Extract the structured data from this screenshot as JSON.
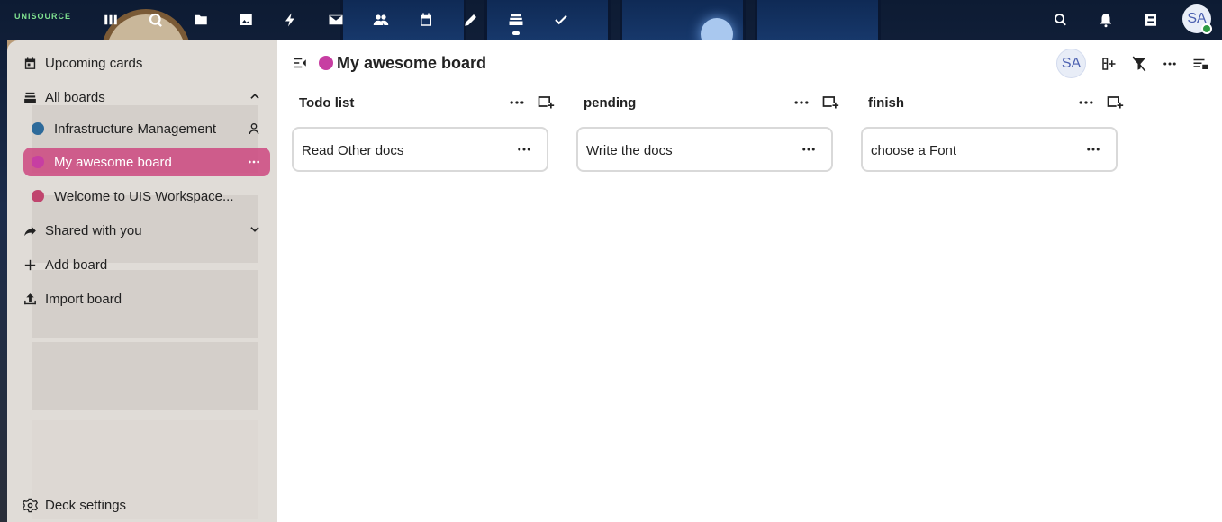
{
  "app": {
    "logo_text": "UNISOURCE",
    "nav_apps": [
      {
        "icon": "dashboard-icon"
      },
      {
        "icon": "search-app-icon"
      },
      {
        "icon": "files-icon"
      },
      {
        "icon": "photos-icon"
      },
      {
        "icon": "activity-icon"
      },
      {
        "icon": "mail-icon"
      },
      {
        "icon": "contacts-icon"
      },
      {
        "icon": "calendar-icon"
      },
      {
        "icon": "notes-icon"
      },
      {
        "icon": "deck-icon",
        "active": true
      },
      {
        "icon": "tasks-icon"
      }
    ],
    "right_icons": [
      "search-icon",
      "notifications-icon",
      "contacts-menu-icon"
    ],
    "user_initials": "SA",
    "user_status_color": "#2e9b43"
  },
  "sidebar": {
    "upcoming_label": "Upcoming cards",
    "all_boards_label": "All boards",
    "boards": [
      {
        "name": "Infrastructure Management",
        "color": "#2d6a9a",
        "shared": true
      },
      {
        "name": "My awesome board",
        "color": "#c73ea2",
        "active": true
      },
      {
        "name": "Welcome to UIS Workspace...",
        "color": "#c0456e"
      }
    ],
    "shared_label": "Shared with you",
    "add_board_label": "Add board",
    "import_board_label": "Import board",
    "settings_label": "Deck settings"
  },
  "board": {
    "title": "My awesome board",
    "color": "#c73ea2",
    "member_initials": "SA",
    "stacks": [
      {
        "title": "Todo list",
        "cards": [
          {
            "title": "Read Other docs"
          }
        ]
      },
      {
        "title": "pending",
        "cards": [
          {
            "title": "Write the docs"
          }
        ]
      },
      {
        "title": "finish",
        "cards": [
          {
            "title": "choose a Font"
          }
        ]
      }
    ]
  },
  "colors": {
    "accent": "#c73ea2",
    "active_board_bg": "#cc4880"
  }
}
